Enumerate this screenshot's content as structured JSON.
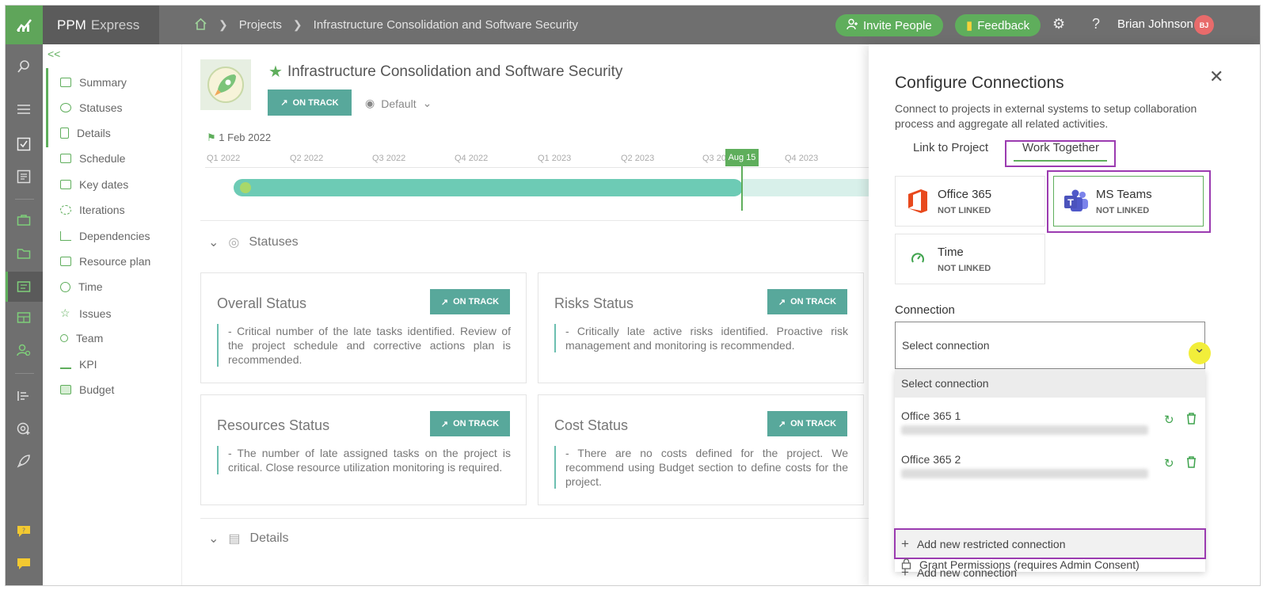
{
  "topbar": {
    "app_name": "PPM",
    "app_name_2": "Express",
    "breadcrumb": [
      "Projects",
      "Infrastructure Consolidation and Software Security"
    ],
    "invite_label": "Invite People",
    "feedback_label": "Feedback",
    "user_name": "Brian Johnson",
    "user_initials": "BJ"
  },
  "subnav": {
    "items": [
      {
        "label": "Summary",
        "icon": "summary-icon"
      },
      {
        "label": "Statuses",
        "icon": "statuses-icon"
      },
      {
        "label": "Details",
        "icon": "details-icon"
      },
      {
        "label": "Schedule",
        "icon": "schedule-icon"
      },
      {
        "label": "Key dates",
        "icon": "key-dates-icon"
      },
      {
        "label": "Iterations",
        "icon": "iterations-icon"
      },
      {
        "label": "Dependencies",
        "icon": "dependencies-icon"
      },
      {
        "label": "Resource plan",
        "icon": "resource-plan-icon"
      },
      {
        "label": "Time",
        "icon": "time-icon"
      },
      {
        "label": "Issues",
        "icon": "issues-icon"
      },
      {
        "label": "Team",
        "icon": "team-icon"
      },
      {
        "label": "KPI",
        "icon": "kpi-icon"
      },
      {
        "label": "Budget",
        "icon": "budget-icon"
      }
    ]
  },
  "project": {
    "title": "Infrastructure Consolidation and Software Security",
    "status": "ON TRACK",
    "view": "Default",
    "start_date": "1 Feb 2022",
    "timeline_labels": [
      "Q1 2022",
      "Q2 2022",
      "Q3 2022",
      "Q4 2022",
      "Q1 2023",
      "Q2 2023",
      "Q3 2023",
      "Q4 2023"
    ],
    "today_label": "Aug 15"
  },
  "sections": {
    "statuses": "Statuses",
    "details": "Details"
  },
  "status_cards": [
    {
      "title": "Overall Status",
      "badge": "ON TRACK",
      "text": "- Critical number of the late tasks identified. Review of the project schedule and corrective actions plan is recommended."
    },
    {
      "title": "Risks Status",
      "badge": "ON TRACK",
      "text": "- Critically late active risks identified. Proactive risk management and monitoring is recommended."
    },
    {
      "title": "Resources Status",
      "badge": "ON TRACK",
      "text": "- The number of late assigned tasks on the project is critical. Close resource utilization monitoring is required."
    },
    {
      "title": "Cost Status",
      "badge": "ON TRACK",
      "text": "- There are no costs defined for the project. We recommend using Budget section to define costs for the project."
    }
  ],
  "panel": {
    "title": "Configure Connections",
    "description": "Connect to projects in external systems to setup collaboration process and aggregate all related activities.",
    "tabs": [
      "Link to Project",
      "Work Together"
    ],
    "services": [
      {
        "name": "Office 365",
        "status": "NOT LINKED"
      },
      {
        "name": "MS Teams",
        "status": "NOT LINKED"
      },
      {
        "name": "Time",
        "status": "NOT LINKED"
      }
    ],
    "connection_label": "Connection",
    "select_value": "Select connection",
    "options": {
      "placeholder": "Select connection",
      "connections": [
        "Office 365 1",
        "Office 365 2"
      ],
      "add_restricted": "Add new restricted connection",
      "add_new": "Add new connection",
      "grant": "Grant Permissions (requires Admin Consent)"
    }
  },
  "colors": {
    "accent_green": "#5fae5c",
    "teal": "#58a89b",
    "highlight_purple": "#9b3bb0"
  }
}
